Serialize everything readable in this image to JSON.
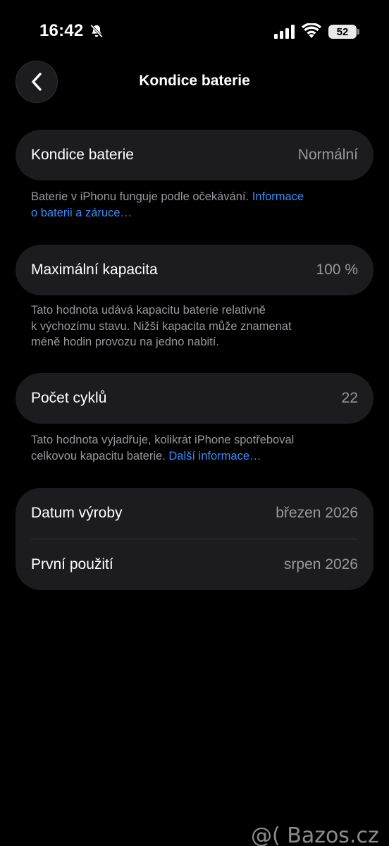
{
  "status_bar": {
    "time": "16:42",
    "battery_level": "52",
    "icons": [
      "bell-slash-icon",
      "signal-icon",
      "wifi-icon",
      "battery-icon"
    ]
  },
  "nav": {
    "title": "Kondice baterie",
    "back_icon": "chevron-left-icon"
  },
  "sections": {
    "health": {
      "label": "Kondice baterie",
      "value": "Normální",
      "note_text": "Baterie v iPhonu funguje podle očekávání. ",
      "note_link_line1": "Informace",
      "note_link_line2": "o baterii a záruce…"
    },
    "capacity": {
      "label": "Maximální kapacita",
      "value": "100 %",
      "note_line1": "Tato hodnota udává kapacitu baterie relativně",
      "note_line2": "k výchozímu stavu. Nižší kapacita může znamenat",
      "note_line3": "méně hodin provozu na jedno nabití."
    },
    "cycles": {
      "label": "Počet cyklů",
      "value": "22",
      "note_line1": "Tato hodnota vyjadřuje, kolikrát iPhone spotřeboval",
      "note_line2": "celkovou kapacitu baterie. ",
      "note_link": "Další informace…"
    },
    "dates": {
      "manufacture_label": "Datum výroby",
      "manufacture_value": "březen 2026",
      "first_use_label": "První použití",
      "first_use_value": "srpen 2026"
    }
  },
  "watermark": "@( Bazos.cz",
  "colors": {
    "background": "#000000",
    "card": "#1c1c1e",
    "secondary_text": "#98989e",
    "link": "#3b8cf7"
  }
}
